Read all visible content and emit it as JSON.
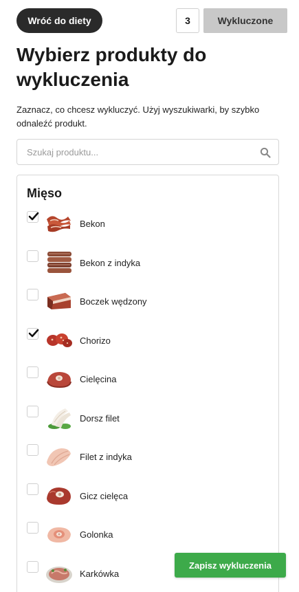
{
  "topbar": {
    "back_label": "Wróć do diety",
    "excluded_count": "3",
    "excluded_label": "Wykluczone"
  },
  "page": {
    "title": "Wybierz produkty do wykluczenia",
    "description": "Zaznacz, co chcesz wykluczyć. Użyj wyszukiwarki, by szybko odnaleźć produkt."
  },
  "search": {
    "placeholder": "Szukaj produktu...",
    "value": ""
  },
  "category": {
    "title": "Mięso",
    "items": [
      {
        "label": "Bekon",
        "checked": true,
        "icon": "bacon-photo"
      },
      {
        "label": "Bekon z indyka",
        "checked": false,
        "icon": "turkey-bacon-photo"
      },
      {
        "label": "Boczek wędzony",
        "checked": false,
        "icon": "smoked-bacon-photo"
      },
      {
        "label": "Chorizo",
        "checked": true,
        "icon": "chorizo-photo"
      },
      {
        "label": "Cielęcina",
        "checked": false,
        "icon": "veal-photo"
      },
      {
        "label": "Dorsz filet",
        "checked": false,
        "icon": "cod-fillet-photo"
      },
      {
        "label": "Filet z indyka",
        "checked": false,
        "icon": "turkey-fillet-photo"
      },
      {
        "label": "Gicz cielęca",
        "checked": false,
        "icon": "veal-shank-photo"
      },
      {
        "label": "Golonka",
        "checked": false,
        "icon": "pork-knuckle-photo"
      },
      {
        "label": "Karkówka",
        "checked": false,
        "icon": "pork-neck-photo"
      }
    ]
  },
  "save": {
    "label": "Zapisz wykluczenia",
    "color": "#3daa4a"
  }
}
